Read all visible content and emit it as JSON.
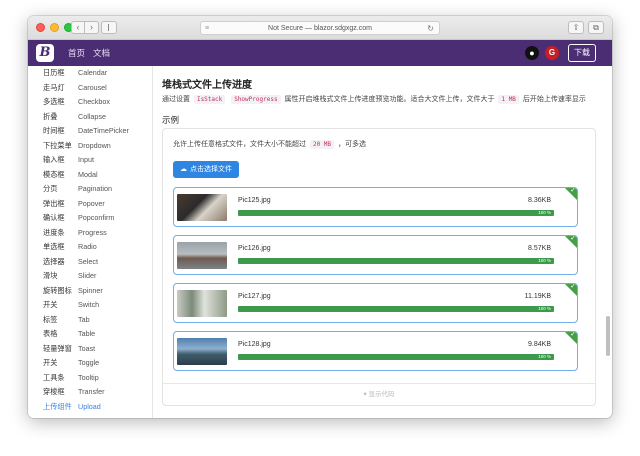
{
  "browser": {
    "url": "Not Secure — blazor.sdgxgz.com"
  },
  "navbar": {
    "brand": "B",
    "links": [
      "首页",
      "文档"
    ],
    "download_label": "下载",
    "accent_color": "#4b2d73"
  },
  "sidebar": {
    "items": [
      {
        "cn": "日历框",
        "en": "Calendar"
      },
      {
        "cn": "走马灯",
        "en": "Carousel"
      },
      {
        "cn": "多选框",
        "en": "Checkbox"
      },
      {
        "cn": "折叠",
        "en": "Collapse"
      },
      {
        "cn": "时间框",
        "en": "DateTimePicker"
      },
      {
        "cn": "下拉菜单",
        "en": "Dropdown"
      },
      {
        "cn": "输入框",
        "en": "Input"
      },
      {
        "cn": "模态框",
        "en": "Modal"
      },
      {
        "cn": "分页",
        "en": "Pagination"
      },
      {
        "cn": "弹出框",
        "en": "Popover"
      },
      {
        "cn": "确认框",
        "en": "Popconfirm"
      },
      {
        "cn": "进度条",
        "en": "Progress"
      },
      {
        "cn": "单选框",
        "en": "Radio"
      },
      {
        "cn": "选择器",
        "en": "Select"
      },
      {
        "cn": "滑块",
        "en": "Slider"
      },
      {
        "cn": "旋转图标",
        "en": "Spinner"
      },
      {
        "cn": "开关",
        "en": "Switch"
      },
      {
        "cn": "标签",
        "en": "Tab"
      },
      {
        "cn": "表格",
        "en": "Table"
      },
      {
        "cn": "轻量弹窗",
        "en": "Toast"
      },
      {
        "cn": "开关",
        "en": "Toggle"
      },
      {
        "cn": "工具条",
        "en": "Tooltip"
      },
      {
        "cn": "穿梭框",
        "en": "Transfer"
      },
      {
        "cn": "上传组件",
        "en": "Upload",
        "active": true
      }
    ]
  },
  "main": {
    "title": "堆栈式文件上传进度",
    "desc_pre": "通过设置",
    "desc_code1": "IsStack",
    "desc_code2": "ShowProgress",
    "desc_mid": "属性开启堆栈式文件上传进度预览功能。适合大文件上传，文件大于",
    "desc_code3": "1 MB",
    "desc_post": "后开始上传速率显示",
    "section": "示例",
    "intro_pre": "允许上传任意格式文件，文件大小不能超过",
    "intro_code": "20 MB",
    "intro_post": "，可多选",
    "upload_button": "点击选择文件",
    "show_code": "显示代码"
  },
  "files": [
    {
      "name": "Pic125.jpg",
      "size": "8.36KB",
      "progress": "100 %",
      "percent": 100
    },
    {
      "name": "Pic126.jpg",
      "size": "8.57KB",
      "progress": "100 %",
      "percent": 100
    },
    {
      "name": "Pic127.jpg",
      "size": "11.19KB",
      "progress": "100 %",
      "percent": 100
    },
    {
      "name": "Pic128.jpg",
      "size": "9.84KB",
      "progress": "100 %",
      "percent": 100
    }
  ]
}
